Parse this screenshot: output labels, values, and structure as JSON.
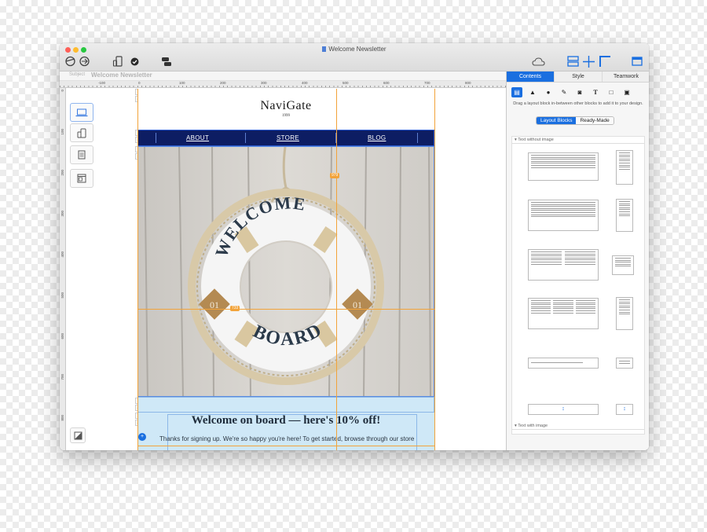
{
  "window": {
    "title": "Welcome Newsletter"
  },
  "subject": {
    "label": "Subject",
    "value": "Welcome Newsletter"
  },
  "ruler": {
    "h_ticks": [
      "-100",
      "0",
      "100",
      "200",
      "300",
      "400",
      "500",
      "600",
      "700",
      "800"
    ],
    "v_ticks": [
      "0",
      "100",
      "200",
      "300",
      "400",
      "500",
      "600",
      "700",
      "800"
    ]
  },
  "email": {
    "logo": "NaviGate",
    "logo_year": "1999",
    "nav": [
      "ABOUT",
      "STORE",
      "BLOG"
    ],
    "hero_ring_top": "WELCOME",
    "hero_ring_bottom": "BOARD",
    "hero_tag": "01",
    "headline": "Welcome on board — here's 10% off!",
    "body": "Thanks for signing up. We're so happy you're here! To get started, browse through our store"
  },
  "guides": {
    "width_badge": "979",
    "height_badge": "733"
  },
  "panel": {
    "tabs": [
      "Contents",
      "Style",
      "Teamwork"
    ],
    "active_tab": "Contents",
    "hint": "Drag a layout block in-between other blocks to add it to your design.",
    "segments": [
      "Layout Blocks",
      "Ready-Made"
    ],
    "active_segment": "Layout Blocks",
    "sections": [
      "Text without image",
      "Text with image"
    ]
  },
  "colors": {
    "accent": "#1a6fe0",
    "nav_bg": "#0d1d63",
    "guide": "#f2a33a",
    "textblock_bg": "#cfe8f7"
  }
}
